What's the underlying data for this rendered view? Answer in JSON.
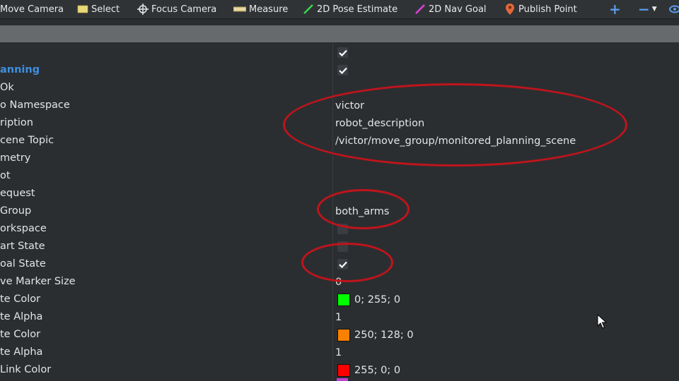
{
  "toolbar": {
    "move_camera": "Move Camera",
    "select": "Select",
    "focus_camera": "Focus Camera",
    "measure": "Measure",
    "pose_estimate": "2D Pose Estimate",
    "nav_goal": "2D Nav Goal",
    "publish_point": "Publish Point",
    "add": "+",
    "remove": "−"
  },
  "colors": {
    "annotation": "#c0141c",
    "category_text": "#3d8fe0",
    "pose_estimate_icon": "#38d84a",
    "nav_goal_icon": "#e040e0",
    "publish_point_icon": "#e0683a"
  },
  "properties": [
    {
      "name": "",
      "value": "",
      "type": "checkbox",
      "checked": true
    },
    {
      "name": "anning",
      "value": "",
      "type": "checkbox",
      "checked": true,
      "category": true
    },
    {
      "name": "Ok",
      "value": "",
      "type": "text"
    },
    {
      "name": "o Namespace",
      "value": "victor",
      "type": "text"
    },
    {
      "name": "ription",
      "value": "robot_description",
      "type": "text"
    },
    {
      "name": "cene Topic",
      "value": "/victor/move_group/monitored_planning_scene",
      "type": "text"
    },
    {
      "name": "metry",
      "value": "",
      "type": "text"
    },
    {
      "name": "ot",
      "value": "",
      "type": "text"
    },
    {
      "name": "equest",
      "value": "",
      "type": "text"
    },
    {
      "name": " Group",
      "value": "both_arms",
      "type": "text"
    },
    {
      "name": "orkspace",
      "value": "",
      "type": "checkbox",
      "checked": false
    },
    {
      "name": "art State",
      "value": "",
      "type": "checkbox",
      "checked": false
    },
    {
      "name": "oal State",
      "value": "",
      "type": "checkbox",
      "checked": true
    },
    {
      "name": "ve Marker Size",
      "value": "0",
      "type": "text"
    },
    {
      "name": "te Color",
      "value": "0; 255; 0",
      "type": "color",
      "color": "#00ff00"
    },
    {
      "name": "te Alpha",
      "value": "1",
      "type": "text"
    },
    {
      "name": "te Color",
      "value": "250; 128; 0",
      "type": "color",
      "color": "#fa8000"
    },
    {
      "name": "te Alpha",
      "value": "1",
      "type": "text"
    },
    {
      "name": " Link Color",
      "value": "255; 0; 0",
      "type": "color",
      "color": "#ff0000"
    }
  ]
}
